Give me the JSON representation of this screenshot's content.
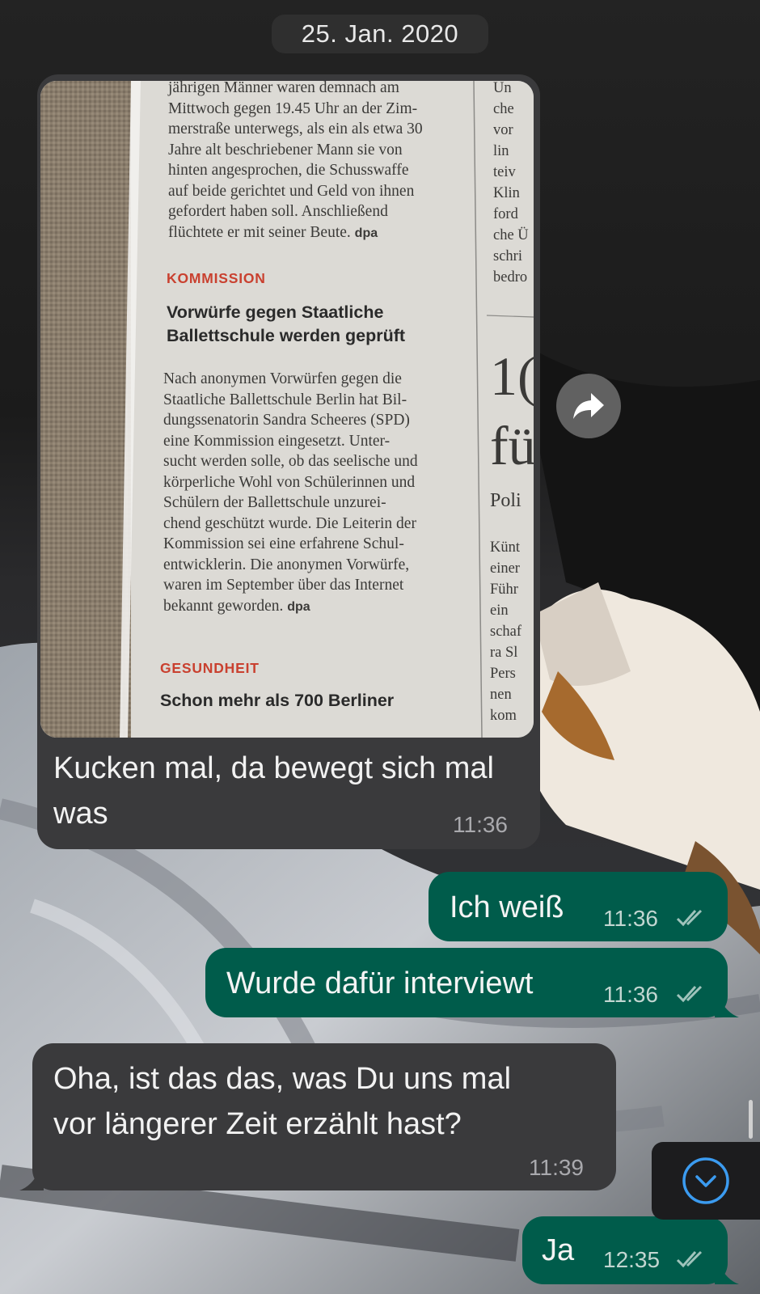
{
  "date_chip": "25. Jan. 2020",
  "messages": [
    {
      "id": "m1",
      "direction": "incoming",
      "type": "image",
      "caption": "Kucken mal,  da bewegt sich mal was",
      "time": "11:36",
      "image": {
        "article_prev_end": [
          "jährigen Männer waren demnach am",
          "Mittwoch gegen 19.45 Uhr an der Zim-",
          "merstraße unterwegs, als ein als etwa 30",
          "Jahre alt beschriebener Mann sie von",
          "hinten angesprochen, die Schusswaffe",
          "auf beide gerichtet und Geld von ihnen",
          "gefordert haben soll. Anschließend",
          "flüchtete er mit seiner Beute."
        ],
        "dpa": "dpa",
        "kicker_1": "KOMMISSION",
        "headline_1": [
          "Vorwürfe gegen Staatliche",
          "Ballettschule werden geprüft"
        ],
        "article_1": [
          "Nach anonymen Vorwürfen gegen die",
          "Staatliche Ballettschule Berlin hat Bil-",
          "dungssenatorin Sandra Scheeres (SPD)",
          "eine Kommission eingesetzt. Unter-",
          "sucht werden solle, ob das seelische und",
          "körperliche Wohl von Schülerinnen und",
          "Schülern der Ballettschule unzurei-",
          "chend geschützt wurde. Die Leiterin der",
          "Kommission sei eine erfahrene Schul-",
          "entwicklerin. Die anonymen Vorwürfe,",
          "waren im September über das Internet",
          "bekannt geworden."
        ],
        "kicker_2": "GESUNDHEIT",
        "headline_2": "Schon mehr als 700 Berliner",
        "right_column_top": [
          "Un",
          "che",
          "vor",
          "lin",
          "teiv",
          "Klin",
          "ford",
          "che Ü",
          "schri",
          "bedro"
        ],
        "right_big": [
          "1(",
          "fü"
        ],
        "right_sub": "Poli",
        "right_column_bottom": [
          "Künt",
          "einer",
          "Führ",
          "ein",
          "schaf",
          "ra Sl",
          "Pers",
          "nen",
          "kom"
        ]
      }
    },
    {
      "id": "m2",
      "direction": "outgoing",
      "text": "Ich weiß",
      "time": "11:36",
      "status": "read"
    },
    {
      "id": "m3",
      "direction": "outgoing",
      "text": "Wurde dafür interviewt",
      "time": "11:36",
      "status": "read"
    },
    {
      "id": "m4",
      "direction": "incoming",
      "text_lines": [
        "Oha,  ist das das, was Du uns mal",
        "vor längerer Zeit erzählt hast?"
      ],
      "time": "11:39"
    },
    {
      "id": "m5",
      "direction": "outgoing",
      "text": "Ja",
      "time": "12:35",
      "status": "read"
    }
  ],
  "icons": {
    "forward": "forward-icon",
    "scroll_down": "chevron-down-icon",
    "read_receipt": "double-check-icon"
  },
  "colors": {
    "incoming_bubble": "#3a3a3c",
    "outgoing_bubble": "#005c4b",
    "date_chip": "#2f2f2f",
    "scroll_button_accent": "#3b9bf0"
  }
}
